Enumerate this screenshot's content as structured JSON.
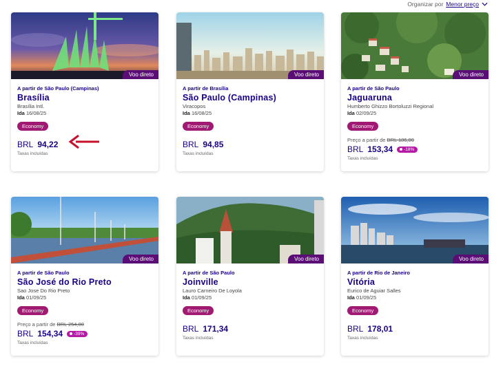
{
  "sort": {
    "label": "Organizar por",
    "value": "Menor preço"
  },
  "common": {
    "direct_badge": "Voo direto",
    "cabin": "Economy",
    "taxes": "Taxas incluídas",
    "currency": "BRL",
    "old_price_prefix": "Preço a partir de"
  },
  "cards": [
    {
      "from": "A partir de São Paulo (Campinas)",
      "city": "Brasília",
      "airport": "Brasília Intl.",
      "date_label": "Ida",
      "date": "16/08/25",
      "price": "94,22"
    },
    {
      "from": "A partir de Brasília",
      "city": "São Paulo (Campinas)",
      "airport": "Viracopos",
      "date_label": "Ida",
      "date": "16/08/25",
      "price": "94,85"
    },
    {
      "from": "A partir de São Paulo",
      "city": "Jaguaruna",
      "airport": "Humberto Ghizzo Bortoluzzi Regional",
      "date_label": "Ida",
      "date": "02/09/25",
      "old_price": "BRL 186,00",
      "price": "153,34",
      "discount": "-18%"
    },
    {
      "from": "A partir de São Paulo",
      "city": "São José do Rio Preto",
      "airport": "Sao Jose Do Rio Preto",
      "date_label": "Ida",
      "date": "01/09/25",
      "old_price": "BRL 254,00",
      "price": "154,34",
      "discount": "-39%"
    },
    {
      "from": "A partir de São Paulo",
      "city": "Joinville",
      "airport": "Lauro Carneiro De Loyola",
      "date_label": "Ida",
      "date": "01/09/25",
      "price": "171,34"
    },
    {
      "from": "A partir de Rio de Janeiro",
      "city": "Vitória",
      "airport": "Eurico de Aguiar Salles",
      "date_label": "Ida",
      "date": "01/09/25",
      "price": "178,01"
    }
  ],
  "colors": {
    "brand": "#1b0088",
    "cabin_badge": "#a01a73",
    "direct_badge": "#5a0e75",
    "discount": "#b51aa6",
    "arrow": "#c8102e"
  },
  "icons": {
    "sort": "chevron-down-icon",
    "annotation": "red-arrow-icon",
    "discount": "tag-icon"
  }
}
